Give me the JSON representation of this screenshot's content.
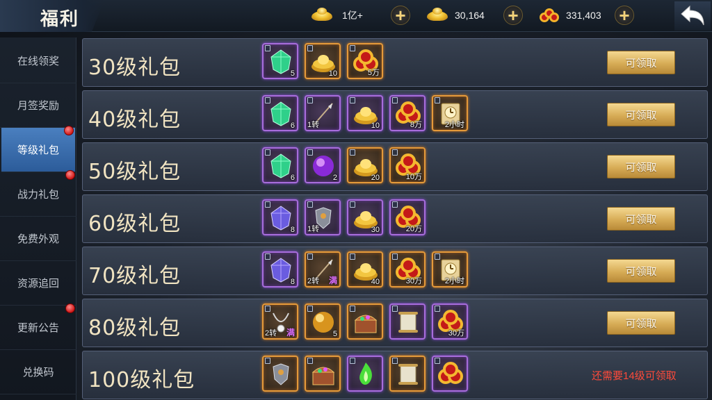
{
  "header": {
    "title": "福利",
    "currencies": [
      {
        "icon": "gold-ingot-icon",
        "value": "1亿+"
      },
      {
        "icon": "silver-ingot-icon",
        "value": "30,164"
      },
      {
        "icon": "copper-coins-icon",
        "value": "331,403"
      }
    ],
    "back_icon": "back-arrow-icon"
  },
  "sidebar": {
    "items": [
      {
        "label": "在线领奖",
        "active": false,
        "dot": false
      },
      {
        "label": "月签奖励",
        "active": false,
        "dot": false
      },
      {
        "label": "等级礼包",
        "active": true,
        "dot": true
      },
      {
        "label": "战力礼包",
        "active": false,
        "dot": true
      },
      {
        "label": "免费外观",
        "active": false,
        "dot": false
      },
      {
        "label": "资源追回",
        "active": false,
        "dot": false
      },
      {
        "label": "更新公告",
        "active": false,
        "dot": true
      },
      {
        "label": "兑换码",
        "active": false,
        "dot": false
      }
    ]
  },
  "packs": [
    {
      "title": "30级礼包",
      "button": "可领取",
      "items": [
        {
          "icon": "green-gem-icon",
          "rarity": "purple",
          "count": "5",
          "tag": "",
          "man": ""
        },
        {
          "icon": "gold-ingot-icon",
          "rarity": "orange",
          "count": "10",
          "tag": "",
          "man": ""
        },
        {
          "icon": "copper-coins-icon",
          "rarity": "orange",
          "count": "5万",
          "tag": "",
          "man": ""
        }
      ]
    },
    {
      "title": "40级礼包",
      "button": "可领取",
      "items": [
        {
          "icon": "green-gem-icon",
          "rarity": "purple",
          "count": "6",
          "tag": "",
          "man": ""
        },
        {
          "icon": "spear-icon",
          "rarity": "purple",
          "count": "",
          "tag": "1转",
          "man": ""
        },
        {
          "icon": "gold-ingot-icon",
          "rarity": "purple",
          "count": "10",
          "tag": "",
          "man": ""
        },
        {
          "icon": "copper-coins-icon",
          "rarity": "purple",
          "count": "8万",
          "tag": "",
          "man": ""
        },
        {
          "icon": "exp-card-icon",
          "rarity": "orange",
          "count": "2小时",
          "tag": "",
          "man": ""
        }
      ]
    },
    {
      "title": "50级礼包",
      "button": "可领取",
      "items": [
        {
          "icon": "green-gem-icon",
          "rarity": "purple",
          "count": "6",
          "tag": "",
          "man": ""
        },
        {
          "icon": "purple-orb-icon",
          "rarity": "purple",
          "count": "2",
          "tag": "",
          "man": ""
        },
        {
          "icon": "gold-ingot-icon",
          "rarity": "orange",
          "count": "20",
          "tag": "",
          "man": ""
        },
        {
          "icon": "copper-coins-icon",
          "rarity": "orange",
          "count": "10万",
          "tag": "",
          "man": ""
        }
      ]
    },
    {
      "title": "60级礼包",
      "button": "可领取",
      "items": [
        {
          "icon": "blue-gem-icon",
          "rarity": "purple",
          "count": "8",
          "tag": "",
          "man": ""
        },
        {
          "icon": "armor-icon",
          "rarity": "purple",
          "count": "",
          "tag": "1转",
          "man": ""
        },
        {
          "icon": "gold-ingot-icon",
          "rarity": "purple",
          "count": "30",
          "tag": "",
          "man": ""
        },
        {
          "icon": "copper-coins-icon",
          "rarity": "purple",
          "count": "20万",
          "tag": "",
          "man": ""
        }
      ]
    },
    {
      "title": "70级礼包",
      "button": "可领取",
      "items": [
        {
          "icon": "blue-gem-icon",
          "rarity": "purple",
          "count": "8",
          "tag": "",
          "man": ""
        },
        {
          "icon": "spear-icon",
          "rarity": "orange",
          "count": "",
          "tag": "2转",
          "man": "满"
        },
        {
          "icon": "gold-ingot-icon",
          "rarity": "orange",
          "count": "40",
          "tag": "",
          "man": ""
        },
        {
          "icon": "copper-coins-icon",
          "rarity": "orange",
          "count": "30万",
          "tag": "",
          "man": ""
        },
        {
          "icon": "exp-card-icon",
          "rarity": "orange",
          "count": "2小时",
          "tag": "",
          "man": ""
        }
      ]
    },
    {
      "title": "80级礼包",
      "button": "可领取",
      "items": [
        {
          "icon": "necklace-icon",
          "rarity": "orange",
          "count": "",
          "tag": "2转",
          "man": "满"
        },
        {
          "icon": "gold-orb-icon",
          "rarity": "orange",
          "count": "5",
          "tag": "",
          "man": ""
        },
        {
          "icon": "treasure-chest-icon",
          "rarity": "orange",
          "count": "",
          "tag": "",
          "man": ""
        },
        {
          "icon": "scroll-icon",
          "rarity": "purple",
          "count": "",
          "tag": "",
          "man": ""
        },
        {
          "icon": "copper-coins-icon",
          "rarity": "purple",
          "count": "30万",
          "tag": "",
          "man": ""
        }
      ]
    },
    {
      "title": "100级礼包",
      "button": "",
      "need": "还需要14级可领取",
      "items": [
        {
          "icon": "armor-icon",
          "rarity": "orange",
          "count": "",
          "tag": "",
          "man": ""
        },
        {
          "icon": "treasure-chest-icon",
          "rarity": "orange",
          "count": "",
          "tag": "",
          "man": ""
        },
        {
          "icon": "green-flame-icon",
          "rarity": "purple",
          "count": "",
          "tag": "",
          "man": ""
        },
        {
          "icon": "scroll-icon",
          "rarity": "orange",
          "count": "",
          "tag": "",
          "man": ""
        },
        {
          "icon": "copper-coins-icon",
          "rarity": "purple",
          "count": "",
          "tag": "",
          "man": ""
        }
      ]
    }
  ]
}
